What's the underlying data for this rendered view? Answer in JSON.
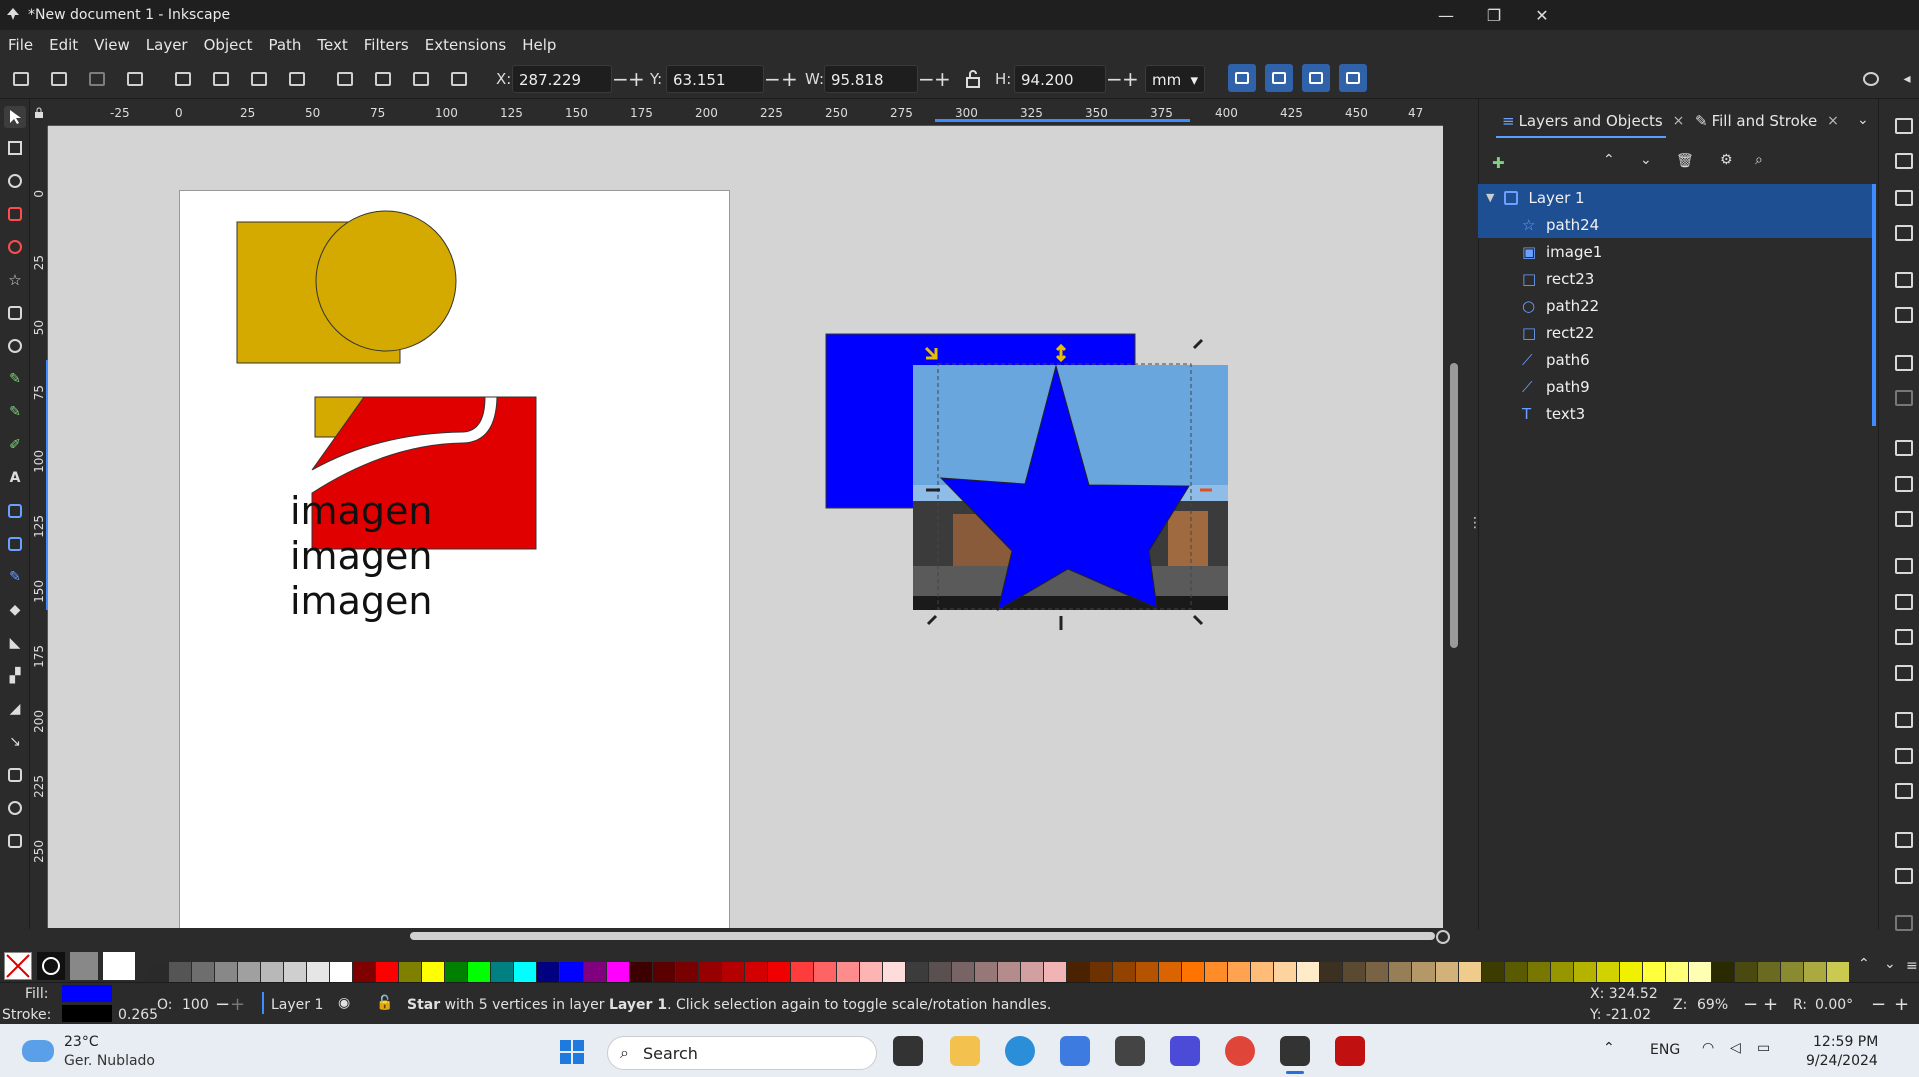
{
  "window": {
    "title": "*New document 1 - Inkscape",
    "minimize": "—",
    "restore": "❐",
    "close": "✕"
  },
  "menu": [
    "File",
    "Edit",
    "View",
    "Layer",
    "Object",
    "Path",
    "Text",
    "Filters",
    "Extensions",
    "Help"
  ],
  "toolbar": {
    "x_label": "X:",
    "x_value": "287.229",
    "y_label": "Y:",
    "y_value": "63.151",
    "w_label": "W:",
    "w_value": "95.818",
    "h_label": "H:",
    "h_value": "94.200",
    "unit": "mm",
    "minus": "−",
    "plus": "+"
  },
  "ruler": {
    "h_ticks": [
      "-25",
      "0",
      "25",
      "50",
      "75",
      "100",
      "125",
      "150",
      "175",
      "200",
      "225",
      "250",
      "275",
      "300",
      "325",
      "350",
      "375",
      "400",
      "425",
      "450",
      "47"
    ],
    "v_ticks": [
      "0",
      "25",
      "50",
      "75",
      "100",
      "125",
      "150",
      "175",
      "200",
      "225",
      "250"
    ]
  },
  "canvas": {
    "text_lines": [
      "imagen",
      "imagen",
      "imagen"
    ]
  },
  "panel": {
    "tab1": "Layers and Objects",
    "tab2": "Fill and Stroke",
    "close": "×",
    "layer": "Layer 1",
    "objects": [
      {
        "label": "path24",
        "icon": "star-icon"
      },
      {
        "label": "image1",
        "icon": "image-icon"
      },
      {
        "label": "rect23",
        "icon": "rect-icon"
      },
      {
        "label": "path22",
        "icon": "circle-icon"
      },
      {
        "label": "rect22",
        "icon": "rect-icon"
      },
      {
        "label": "path6",
        "icon": "path-icon"
      },
      {
        "label": "path9",
        "icon": "path-icon"
      },
      {
        "label": "text3",
        "icon": "text-icon"
      }
    ]
  },
  "palette_colors": [
    "#2a2a2a",
    "#555555",
    "#6e6e6e",
    "#888888",
    "#a0a0a0",
    "#b8b8b8",
    "#cfcfcf",
    "#e6e6e6",
    "#ffffff",
    "#800000",
    "#ff0000",
    "#808000",
    "#ffff00",
    "#008000",
    "#00ff00",
    "#008080",
    "#00ffff",
    "#000080",
    "#0000ff",
    "#800080",
    "#ff00ff",
    "#3c0000",
    "#5a0000",
    "#780000",
    "#960000",
    "#b40000",
    "#d20000",
    "#f00000",
    "#ff3c3c",
    "#ff6464",
    "#ff8c8c",
    "#ffb4b4",
    "#ffdcdc",
    "#3c3c3c",
    "#5a5050",
    "#786464",
    "#967878",
    "#b48c8c",
    "#d2a0a0",
    "#f0b4b4",
    "#4a2200",
    "#6e3200",
    "#924300",
    "#b65300",
    "#da6400",
    "#ff7400",
    "#ff8c28",
    "#ffa350",
    "#ffbb78",
    "#ffd3a0",
    "#ffebc8",
    "#3c3020",
    "#5a4a32",
    "#786444",
    "#967e56",
    "#b49868",
    "#d2b27a",
    "#f0cc8c",
    "#3c3c00",
    "#5a5a00",
    "#787800",
    "#969600",
    "#b4b400",
    "#d2d200",
    "#f0f000",
    "#ffff3c",
    "#ffff78",
    "#ffffb4",
    "#2a2a00",
    "#4a4a10",
    "#6a6a20",
    "#8a8a30",
    "#aaaa40",
    "#caca50"
  ],
  "status": {
    "fill_label": "Fill:",
    "stroke_label": "Stroke:",
    "stroke_width": "0.265",
    "opacity_label": "O:",
    "opacity_value": "100",
    "layer": "Layer 1",
    "message_bold": "Star",
    "message": " with 5 vertices in layer ",
    "message_layer": "Layer 1",
    ". ": ". ",
    "message_tail": ". Click selection again to toggle scale/rotation handles.",
    "x_coord": "X: 324.52",
    "y_coord": "Y: -21.02",
    "zoom_label": "Z:",
    "zoom_value": "69%",
    "rot_label": "R:",
    "rot_value": "0.00°",
    "fill_color": "#0000ff",
    "stroke_color": "#000000"
  },
  "taskbar": {
    "temp": "23°C",
    "weather": "Ger. Nublado",
    "search": "Search",
    "lang": "ENG",
    "time": "12:59 PM",
    "date": "9/24/2024"
  }
}
